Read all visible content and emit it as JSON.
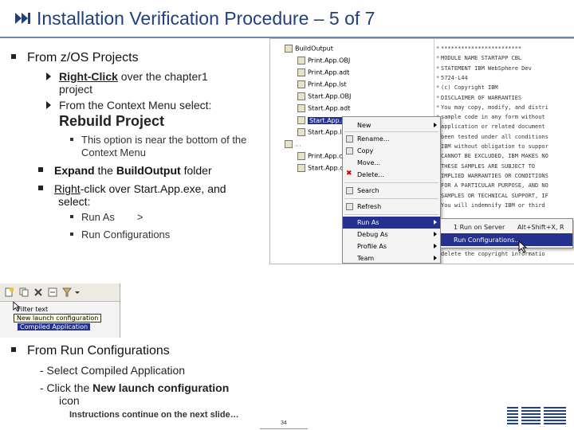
{
  "slide": {
    "title": "Installation Verification Procedure – 5 of 7",
    "footer_note": "Instructions continue on the next slide…",
    "page_number": "34",
    "brand": "IBM",
    "icon": "skip-forward-icon"
  },
  "bullets": {
    "b1": "From z/OS Projects",
    "b1_sub1_bold": "Right-Click",
    "b1_sub1_rest": " over the chapter1",
    "b1_sub1_cont": "project",
    "b1_sub2": "From the Context Menu select:",
    "b1_sub2_big": "Rebuild Project",
    "b1_sub2_note1": "This option is near the bottom of the",
    "b1_sub2_note2": "Context Menu",
    "b2_bold1": "Expand",
    "b2_mid": " the ",
    "b2_bold2": "BuildOutput",
    "b2_rest": " folder",
    "b3_under": "Right",
    "b3_rest": "-click over Start.App.exe, and",
    "b3_cont": "select:",
    "b3_sub1_a": "Run As",
    "b3_sub1_b": ">",
    "b3_sub2": "Run Configurations",
    "b4": "From Run Configurations",
    "b4_line1": "- Select Compiled Application",
    "b4_line2_a": "- Click the ",
    "b4_line2_bold": "New launch configuration",
    "b4_line3": "icon"
  },
  "eclipse": {
    "tree": [
      {
        "label": "BuildOutput",
        "sel": false
      },
      {
        "label": "Print.App.OBJ",
        "sel": false
      },
      {
        "label": "Print.App.adt",
        "sel": false
      },
      {
        "label": "Print.App.lst",
        "sel": false
      },
      {
        "label": "Start.App.OBJ",
        "sel": false
      },
      {
        "label": "Start.App.adt",
        "sel": false
      },
      {
        "label": "Start.App.exe",
        "sel": true
      },
      {
        "label": "Start.App.lst",
        "sel": false
      },
      {
        "label": "Print.App.cbl",
        "sel": false
      },
      {
        "label": "Start.App.cbl",
        "sel": false
      }
    ],
    "code": [
      "************************",
      "MODULE NAME    STARTAPP CBL",
      "STATEMENT      IBM WebSphere Dev",
      "               5724-L44",
      "               (c) Copyright IBM",
      "DISCLAIMER OF WARRANTIES",
      "You may copy, modify, and distri",
      "sample code in any form without",
      "application or related document",
      "been tested under all conditions",
      "IBM without obligation to suppor",
      "CANNOT BE EXCLUDED, IBM MAKES NO",
      "THESE SAMPLES ARE SUBJECT TO",
      "IMPLIED WARRANTIES OR CONDITIONS",
      "FOR A PARTICULAR PURPOSE, AND NO",
      "SAMPLES OR TECHNICAL SUPPORT, IF",
      "You will indemnify IBM or third",
      "",
      "",
      "",
      "",
      "delete the copyright informatio"
    ],
    "menu": [
      {
        "label": "New",
        "chev": true,
        "hl": false
      },
      {
        "label": "Rename...",
        "chev": false,
        "hl": false
      },
      {
        "label": "Copy",
        "chev": false,
        "hl": false
      },
      {
        "label": "Move...",
        "chev": false,
        "hl": false
      },
      {
        "label": "Delete...",
        "chev": false,
        "hl": false
      },
      {
        "label": "Search",
        "chev": false,
        "hl": false
      },
      {
        "label": "Refresh",
        "chev": false,
        "hl": false
      },
      {
        "label": "Run As",
        "chev": true,
        "hl": true
      },
      {
        "label": "Debug As",
        "chev": true,
        "hl": false
      },
      {
        "label": "Profile As",
        "chev": true,
        "hl": false
      },
      {
        "label": "Team",
        "chev": true,
        "hl": false
      }
    ],
    "submenu": [
      {
        "label": "1 Run on Server",
        "short": "Alt+Shift+X, R",
        "hl": false
      },
      {
        "label": "Run Configurations...",
        "short": "",
        "hl": true
      }
    ]
  },
  "toolbar_shot": {
    "row1": "Filter text",
    "tooltip": "New launch configuration",
    "selected": "Compiled Application"
  },
  "colors": {
    "title": "#1f3f7f",
    "selection": "#24318f",
    "ibm_blue": "#1f3f9f"
  }
}
